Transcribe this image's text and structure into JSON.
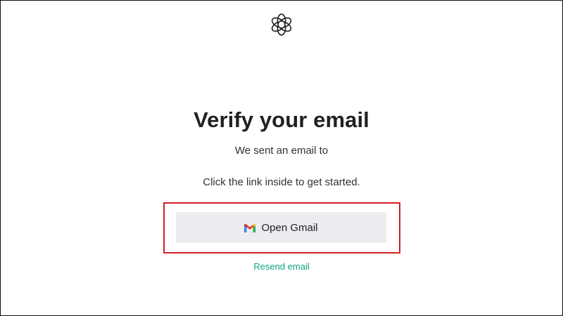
{
  "header": {
    "logo_icon": "openai-logo-icon"
  },
  "main": {
    "title": "Verify your email",
    "sent_text": "We sent an email to",
    "instruction": "Click the link inside to get started.",
    "open_gmail": {
      "label": "Open Gmail",
      "icon": "gmail-icon"
    },
    "resend_label": "Resend email"
  },
  "colors": {
    "highlight": "#d42027",
    "button_background": "#ececf1",
    "link": "#10a37f",
    "text": "#2d333a"
  }
}
